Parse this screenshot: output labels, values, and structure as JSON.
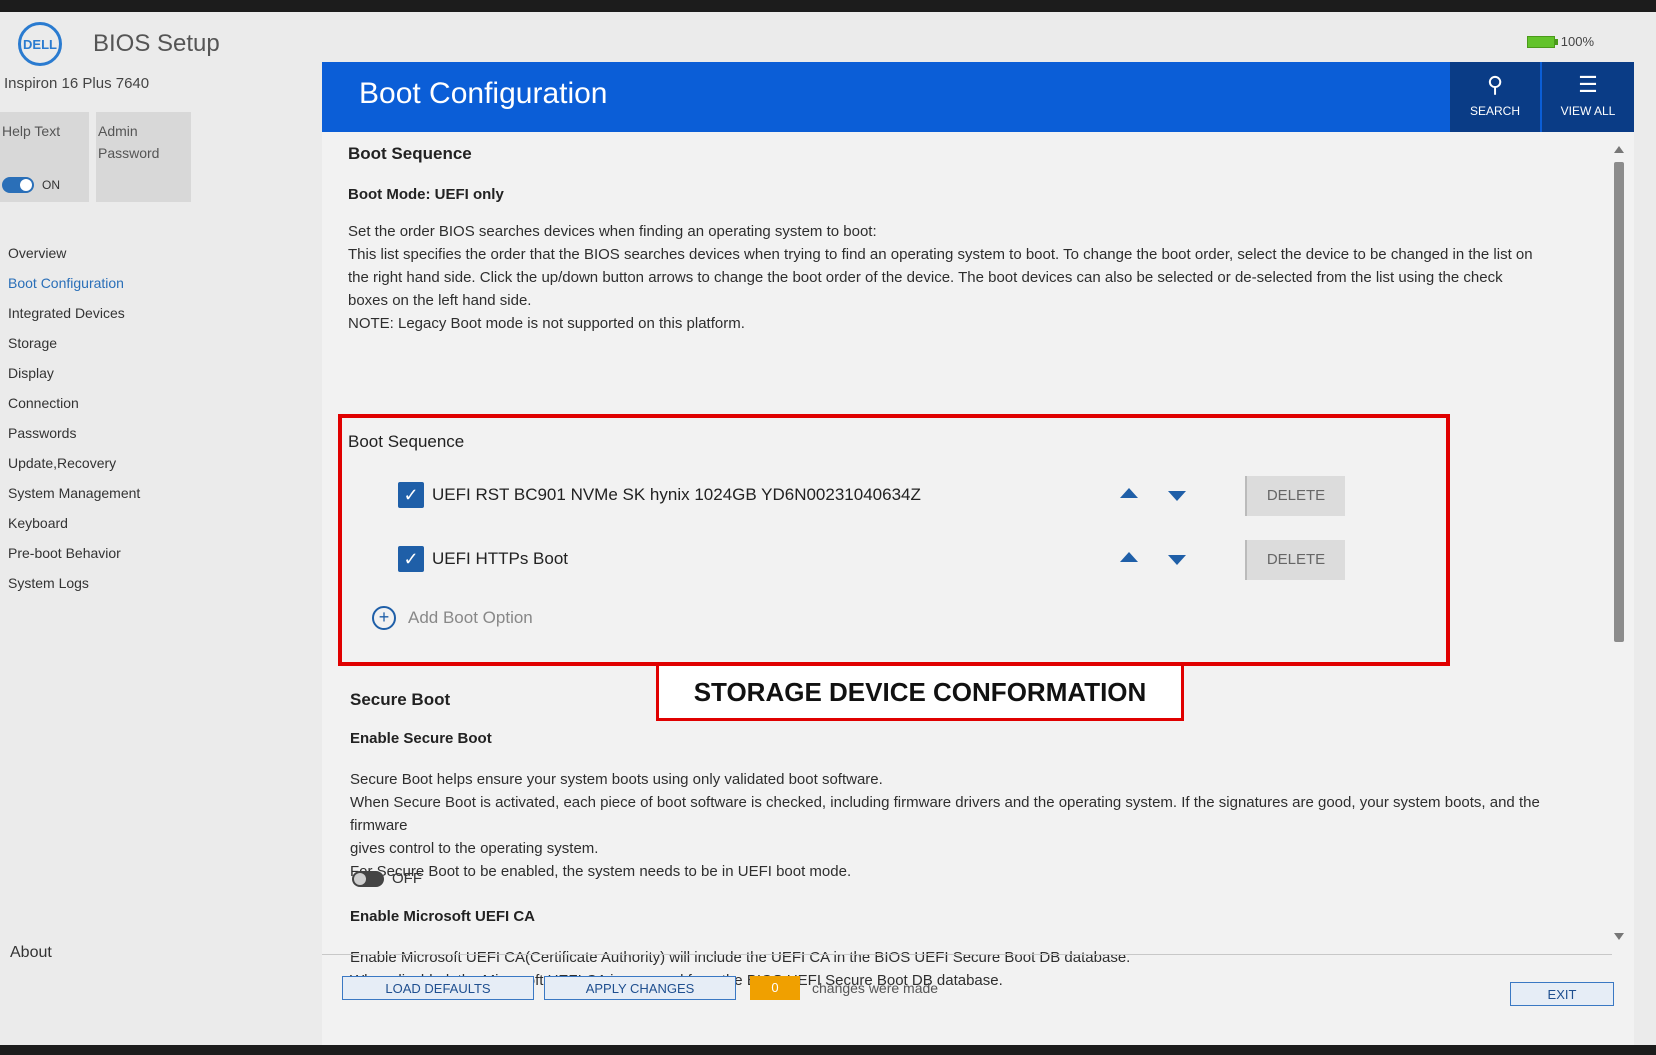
{
  "header": {
    "logo_text": "DELL",
    "app_title": "BIOS Setup",
    "battery_text": "100%",
    "model": "Inspiron 16 Plus 7640"
  },
  "sidebar": {
    "help_text_label": "Help Text",
    "help_text_state": "ON",
    "admin_password_line1": "Admin",
    "admin_password_line2": "Password",
    "items": [
      {
        "label": "Overview"
      },
      {
        "label": "Boot Configuration",
        "active": true
      },
      {
        "label": "Integrated Devices"
      },
      {
        "label": "Storage"
      },
      {
        "label": "Display"
      },
      {
        "label": "Connection"
      },
      {
        "label": "Passwords"
      },
      {
        "label": "Update,Recovery"
      },
      {
        "label": "System Management"
      },
      {
        "label": "Keyboard"
      },
      {
        "label": "Pre-boot Behavior"
      },
      {
        "label": "System Logs"
      }
    ],
    "about": "About"
  },
  "banner": {
    "title": "Boot Configuration",
    "search_label": "SEARCH",
    "view_all_label": "VIEW ALL"
  },
  "boot_sequence": {
    "heading": "Boot Sequence",
    "mode": "Boot Mode: UEFI only",
    "description": [
      "Set the order BIOS searches devices when finding an operating system to boot:",
      "This list specifies the order that the BIOS searches devices when trying to find an operating system to boot.  To change the boot order, select the device to be changed in the list on",
      "the right hand side.  Click the up/down button arrows to change the boot order of the device.  The boot devices can also be selected or de-selected from the list using the check",
      "boxes on the left hand side.",
      "NOTE: Legacy Boot mode is not supported on this platform."
    ],
    "list_title": "Boot Sequence",
    "devices": [
      {
        "label": "UEFI RST BC901 NVMe SK hynix 1024GB YD6N00231040634Z",
        "checked": true,
        "delete_label": "DELETE"
      },
      {
        "label": "UEFI HTTPs Boot",
        "checked": true,
        "delete_label": "DELETE"
      }
    ],
    "add_option": "Add Boot Option"
  },
  "callout": "STORAGE DEVICE CONFORMATION",
  "secure_boot": {
    "heading": "Secure Boot",
    "enable_title": "Enable Secure Boot",
    "description": [
      "Secure Boot helps ensure your system boots using only validated boot software.",
      "When Secure Boot is activated, each piece of boot software is checked, including firmware drivers and the operating system. If the signatures are good, your system boots, and the firmware",
      "gives control to the operating system.",
      "For Secure Boot to be enabled, the system needs to be in UEFI boot mode."
    ],
    "toggle_state": "OFF",
    "ms_ca_title": "Enable Microsoft UEFI CA",
    "ms_ca_description": [
      "Enable Microsoft UEFI CA(Certificate Authority) will include the UEFI CA in the BIOS UEFI Secure Boot DB database.",
      "When disabled, the Microsoft UEFI CA is removed from the BIOS UEFI Secure Boot DB database."
    ]
  },
  "footer": {
    "load_defaults": "LOAD DEFAULTS",
    "apply_changes": "APPLY CHANGES",
    "change_count": "0",
    "changes_text": "changes were made",
    "exit": "EXIT"
  },
  "colors": {
    "banner_blue": "#0b5ed7",
    "banner_button": "#0a3c86",
    "highlight_red": "#e00000",
    "change_badge": "#f0a000"
  }
}
